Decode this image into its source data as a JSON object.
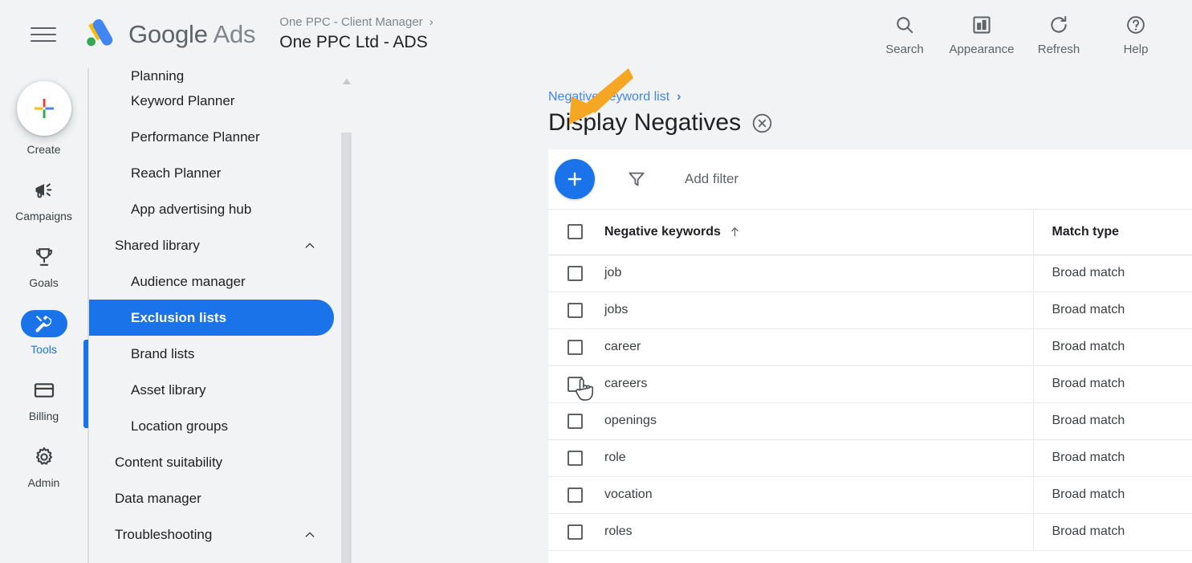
{
  "header": {
    "menu_icon": "hamburger-icon",
    "brand_google": "Google",
    "brand_ads": "Ads",
    "account_manager": "One PPC - Client Manager",
    "account_chevron": "›",
    "account_name": "One PPC Ltd - ADS",
    "actions": [
      {
        "label": "Search",
        "icon": "search-icon"
      },
      {
        "label": "Appearance",
        "icon": "appearance-icon"
      },
      {
        "label": "Refresh",
        "icon": "refresh-icon"
      },
      {
        "label": "Help",
        "icon": "help-icon"
      }
    ]
  },
  "rail": {
    "create_label": "Create",
    "items": [
      {
        "label": "Campaigns",
        "icon": "megaphone-icon",
        "active": false
      },
      {
        "label": "Goals",
        "icon": "trophy-icon",
        "active": false
      },
      {
        "label": "Tools",
        "icon": "tools-icon",
        "active": true
      },
      {
        "label": "Billing",
        "icon": "billing-card-icon",
        "active": false
      },
      {
        "label": "Admin",
        "icon": "gear-icon",
        "active": false
      }
    ]
  },
  "subnav": {
    "clipped_top_item": "Planning",
    "items": [
      {
        "label": "Keyword Planner",
        "level": "child",
        "active": false,
        "expandable": false
      },
      {
        "label": "Performance Planner",
        "level": "child",
        "active": false,
        "expandable": false
      },
      {
        "label": "Reach Planner",
        "level": "child",
        "active": false,
        "expandable": false
      },
      {
        "label": "App advertising hub",
        "level": "child",
        "active": false,
        "expandable": false
      },
      {
        "label": "Shared library",
        "level": "group",
        "active": false,
        "expandable": true
      },
      {
        "label": "Audience manager",
        "level": "child",
        "active": false,
        "expandable": false
      },
      {
        "label": "Exclusion lists",
        "level": "child",
        "active": true,
        "expandable": false
      },
      {
        "label": "Brand lists",
        "level": "child",
        "active": false,
        "expandable": false
      },
      {
        "label": "Asset library",
        "level": "child",
        "active": false,
        "expandable": false
      },
      {
        "label": "Location groups",
        "level": "child",
        "active": false,
        "expandable": false
      },
      {
        "label": "Content suitability",
        "level": "group",
        "active": false,
        "expandable": false
      },
      {
        "label": "Data manager",
        "level": "group",
        "active": false,
        "expandable": false
      },
      {
        "label": "Troubleshooting",
        "level": "group",
        "active": false,
        "expandable": true
      }
    ]
  },
  "content": {
    "breadcrumb": "Negative keyword list",
    "breadcrumb_chevron": "›",
    "page_title": "Display Negatives",
    "close_icon": "close-circle-icon",
    "annotation": {
      "type": "arrow",
      "color": "#F5A623",
      "points_to": "close-circle-icon"
    }
  },
  "toolbar": {
    "add_button_label": "+",
    "filter_icon": "filter-funnel-icon",
    "add_filter_label": "Add filter"
  },
  "table": {
    "columns": [
      {
        "key": "keyword",
        "label": "Negative keywords",
        "sorted": "asc",
        "sort_glyph": "↑"
      },
      {
        "key": "match",
        "label": "Match type",
        "sorted": null
      }
    ],
    "select_all_checked": false,
    "rows": [
      {
        "keyword": "job",
        "match": "Broad match",
        "checked": false
      },
      {
        "keyword": "jobs",
        "match": "Broad match",
        "checked": false
      },
      {
        "keyword": "career",
        "match": "Broad match",
        "checked": false
      },
      {
        "keyword": "careers",
        "match": "Broad match",
        "checked": false
      },
      {
        "keyword": "openings",
        "match": "Broad match",
        "checked": false
      },
      {
        "keyword": "role",
        "match": "Broad match",
        "checked": false
      },
      {
        "keyword": "vocation",
        "match": "Broad match",
        "checked": false
      },
      {
        "keyword": "roles",
        "match": "Broad match",
        "checked": false
      }
    ]
  },
  "cursor": {
    "type": "pointer-hand",
    "over": "row-checkbox-careers"
  },
  "colors": {
    "accent_blue": "#1a73e8",
    "link_blue": "#4285f4",
    "page_bg": "#f1f3f4",
    "card_bg": "#ffffff",
    "text_primary": "#202124",
    "text_secondary": "#5f6368",
    "annotation_orange": "#F5A623"
  }
}
